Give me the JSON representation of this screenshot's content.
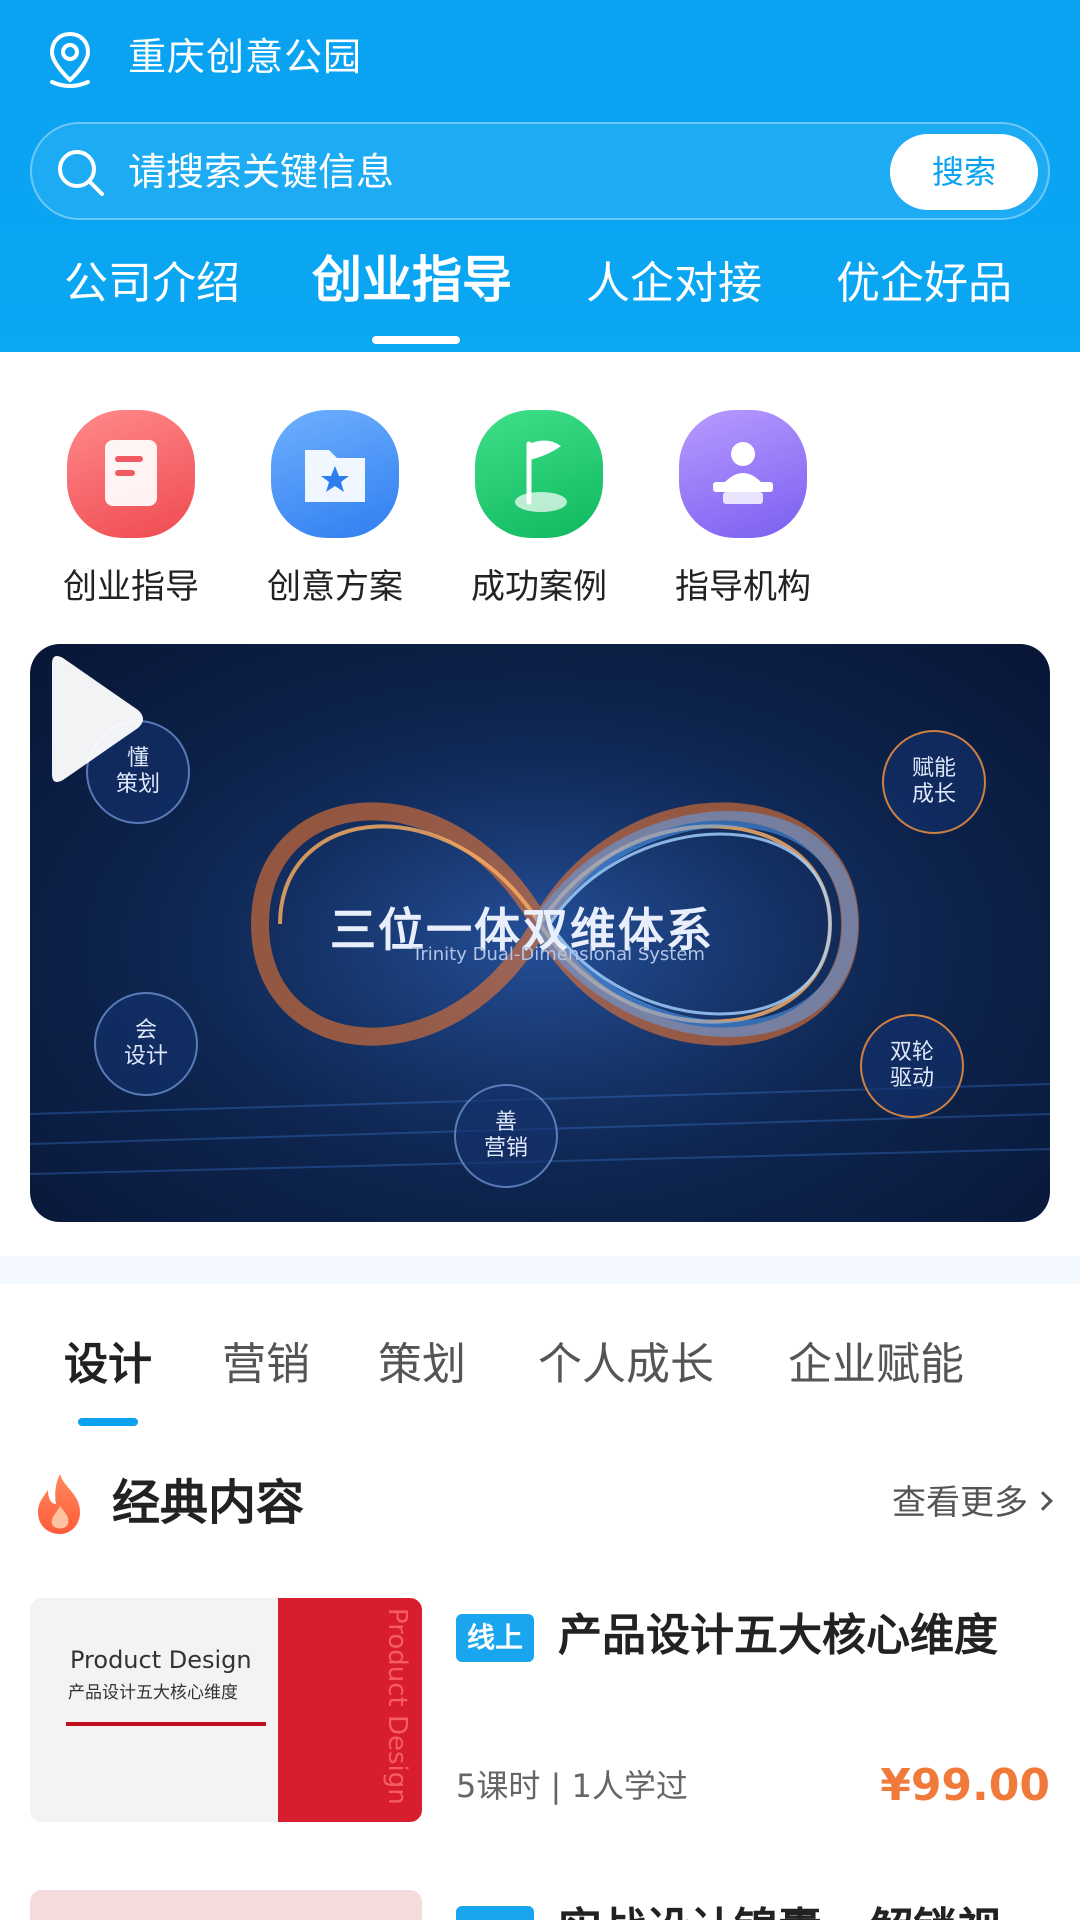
{
  "header": {
    "location": "重庆创意公园",
    "search_placeholder": "请搜索关键信息",
    "search_button": "搜索",
    "nav_tabs": [
      {
        "label": "公司介绍",
        "active": false
      },
      {
        "label": "创业指导",
        "active": true
      },
      {
        "label": "人企对接",
        "active": false
      },
      {
        "label": "优企好品",
        "active": false
      }
    ]
  },
  "quick_links": [
    {
      "label": "创业指导",
      "icon": "document-icon",
      "color": "#f2555a"
    },
    {
      "label": "创意方案",
      "icon": "star-folder-icon",
      "color": "#3f8ef5"
    },
    {
      "label": "成功案例",
      "icon": "flag-icon",
      "color": "#14c46c"
    },
    {
      "label": "指导机构",
      "icon": "lecturer-icon",
      "color": "#8a6df0"
    }
  ],
  "video": {
    "title": "三位一体双维体系",
    "subtitle": "Trinity Dual-Dimensional System",
    "nodes": [
      {
        "line1": "懂",
        "line2": "策划"
      },
      {
        "line1": "赋能",
        "line2": "成长"
      },
      {
        "line1": "会",
        "line2": "设计"
      },
      {
        "line1": "双轮",
        "line2": "驱动"
      },
      {
        "line1": "善",
        "line2": "营销"
      }
    ]
  },
  "category_tabs": [
    {
      "label": "设计",
      "active": true
    },
    {
      "label": "营销",
      "active": false
    },
    {
      "label": "策划",
      "active": false
    },
    {
      "label": "个人成长",
      "active": false
    },
    {
      "label": "企业赋能",
      "active": false
    }
  ],
  "section": {
    "title": "经典内容",
    "more": "查看更多"
  },
  "courses": [
    {
      "badge": "线上",
      "title": "产品设计五大核心维度",
      "meta": "5课时 | 1人学过",
      "price": "¥99.00",
      "thumb_en": "Product Design",
      "thumb_cn": "产品设计五大核心维度",
      "thumb_vertical": "Product Design"
    },
    {
      "badge": "线上",
      "title": "实战设计锦囊 · 解锁视"
    }
  ],
  "colors": {
    "brand": "#0aa2f1",
    "price": "#f07a3a"
  }
}
